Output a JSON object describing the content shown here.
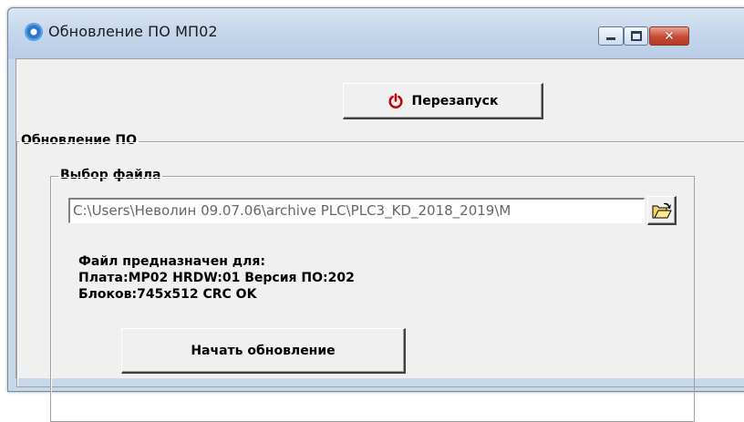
{
  "window": {
    "title": "Обновление ПО МП02",
    "controls": {
      "minimize_icon": "minimize-icon",
      "maximize_icon": "maximize-icon",
      "close_icon": "close-icon",
      "close_glyph": "✕"
    }
  },
  "toolbar": {
    "restart_label": "Перезапуск",
    "restart_icon": "power-icon",
    "restart_icon_color": "#cc0000"
  },
  "update_group": {
    "label": "Обновление ПО",
    "file_group": {
      "label": "Выбор файла",
      "path_value": "C:\\Users\\Неволин 09.07.06\\archive PLC\\PLC3_KD_2018_2019\\M",
      "browse_icon": "open-folder-icon"
    },
    "info": {
      "line1": "Файл предназначен для:",
      "line2": "Плата:MP02 HRDW:01 Версия ПО:202",
      "line3": "Блоков:745x512 CRC OK"
    },
    "start_label": "Начать обновление"
  }
}
